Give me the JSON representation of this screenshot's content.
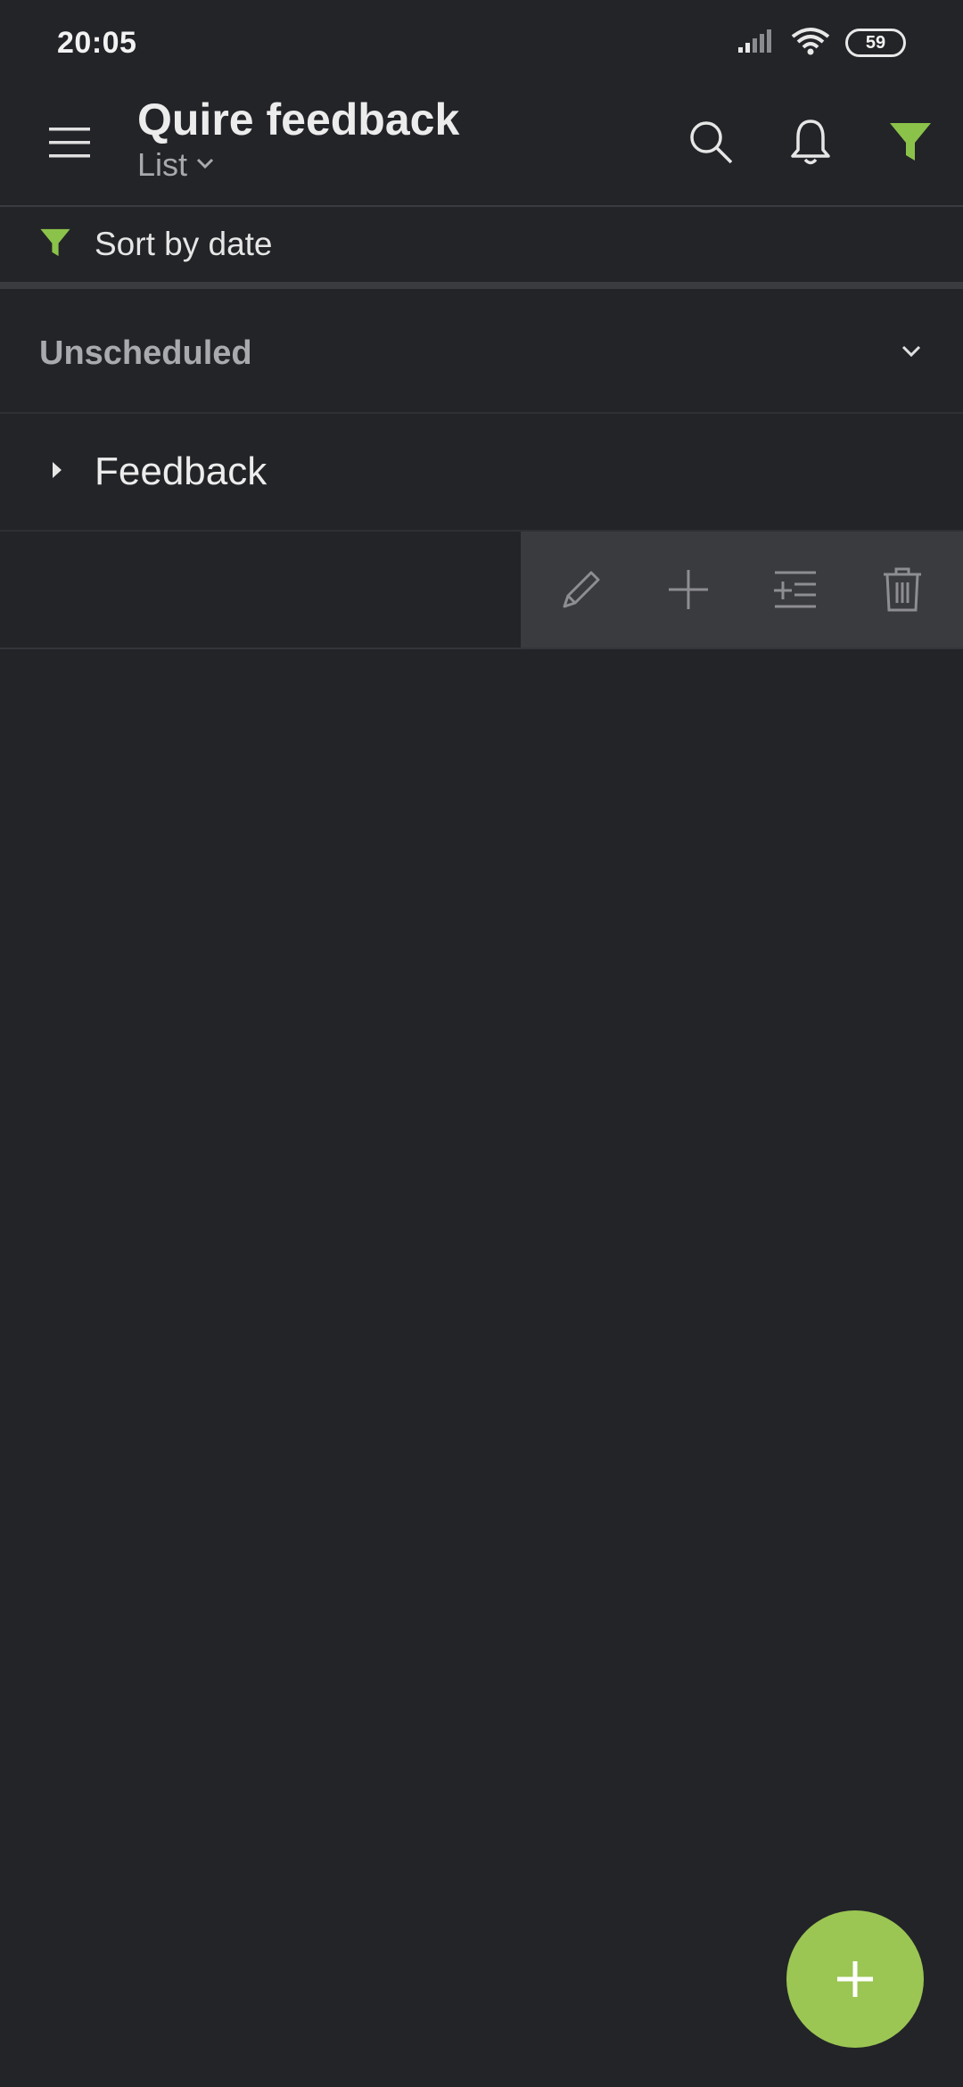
{
  "status_bar": {
    "time": "20:05",
    "battery": "59",
    "icons": [
      "signal-icon",
      "wifi-icon",
      "battery-icon"
    ]
  },
  "app_bar": {
    "title": "Quire feedback",
    "view": "List",
    "actions": [
      "search-icon",
      "bell-icon",
      "filter-icon"
    ]
  },
  "sort_bar": {
    "label": "Sort by date"
  },
  "section": {
    "title": "Unscheduled"
  },
  "task": {
    "title": "Feedback"
  },
  "row_actions": [
    "edit-icon",
    "add-icon",
    "add-subtask-icon",
    "delete-icon"
  ],
  "colors": {
    "background": "#232428",
    "accent": "#9bc653",
    "tray": "#3a3b3f"
  }
}
